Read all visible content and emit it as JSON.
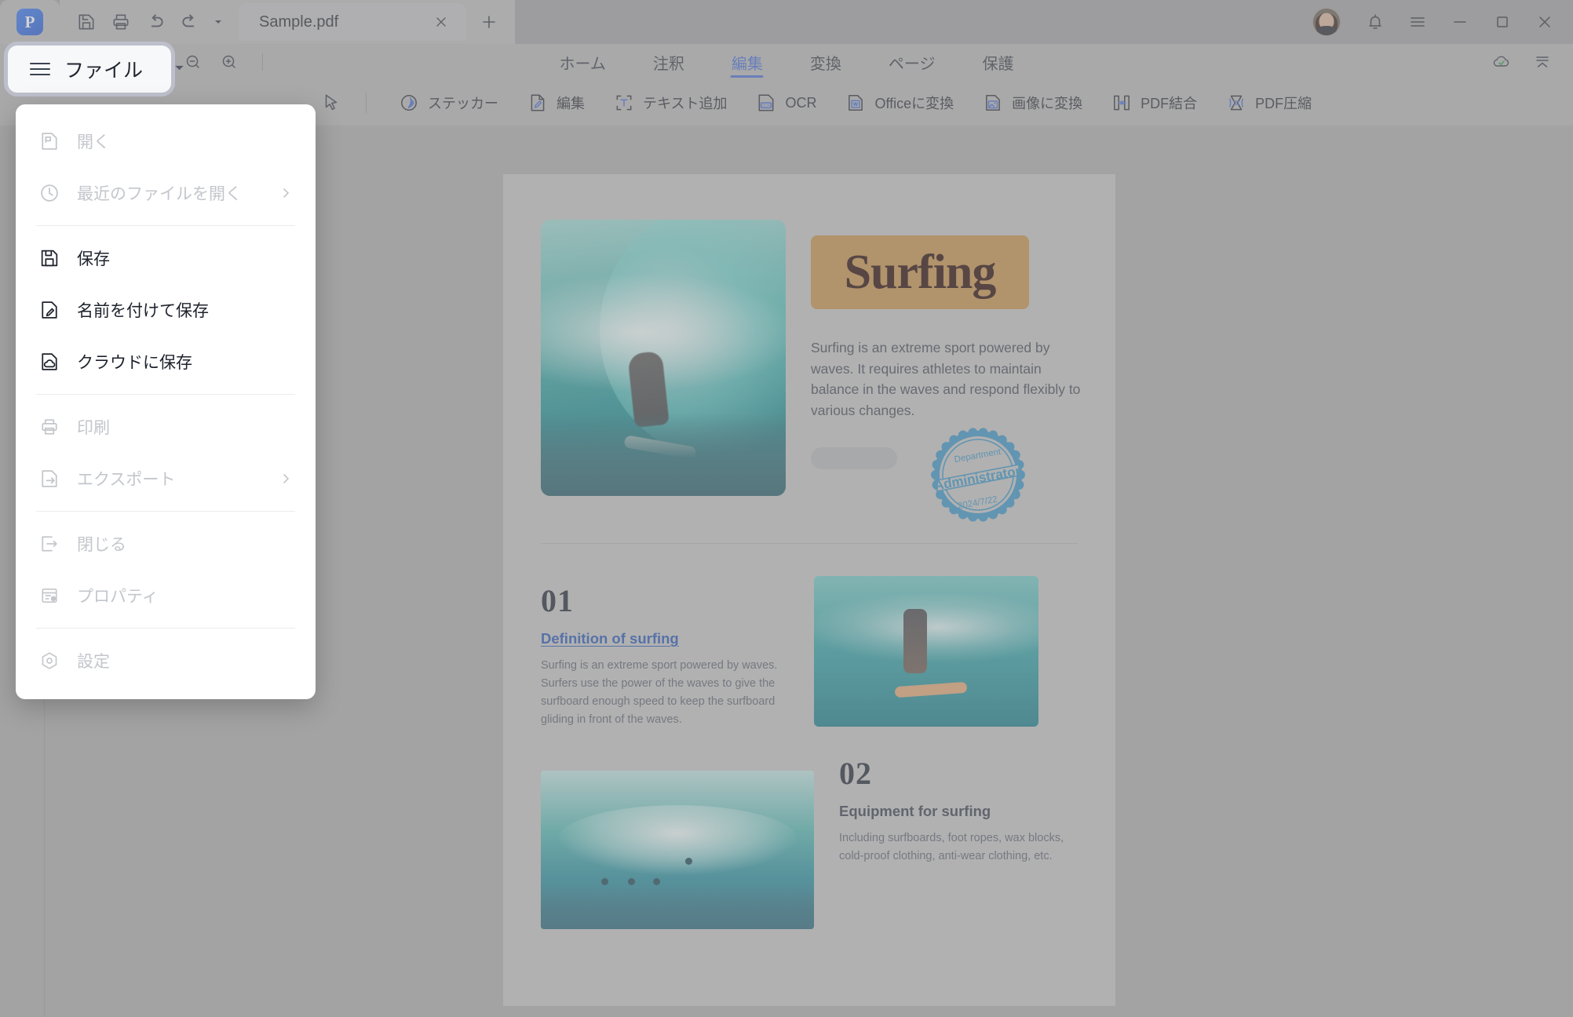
{
  "app": {
    "logo_letter": "P",
    "window_title": "Sample.pdf"
  },
  "titlebar": {
    "quick_access": [
      {
        "name": "save",
        "label": "保存"
      },
      {
        "name": "print",
        "label": "印刷"
      },
      {
        "name": "undo",
        "label": "元に戻す"
      },
      {
        "name": "redo",
        "label": "やり直し"
      }
    ],
    "tab_label": "Sample.pdf",
    "new_tab_label": "+",
    "window_controls": [
      {
        "name": "minimize",
        "label": "—"
      },
      {
        "name": "maximize",
        "label": "□"
      },
      {
        "name": "close",
        "label": "✕"
      }
    ]
  },
  "file_button": {
    "label": "ファイル"
  },
  "zoom_controls": {
    "zoom_out_label": "縮小",
    "zoom_in_label": "拡大"
  },
  "ribbon": {
    "tabs": [
      {
        "label": "ホーム",
        "active": false
      },
      {
        "label": "注釈",
        "active": false
      },
      {
        "label": "編集",
        "active": true
      },
      {
        "label": "変換",
        "active": false
      },
      {
        "label": "ページ",
        "active": false
      },
      {
        "label": "保護",
        "active": false
      }
    ],
    "active_tab": "編集",
    "accent_color": "#4a6fd4"
  },
  "toolbar": {
    "items": [
      {
        "label": "ステッカー",
        "icon": "sticker-icon"
      },
      {
        "label": "編集",
        "icon": "edit-pencil-icon"
      },
      {
        "label": "テキスト追加",
        "icon": "add-text-icon"
      },
      {
        "label": "OCR",
        "icon": "ocr-icon"
      },
      {
        "label": "Officeに変換",
        "icon": "convert-to-office-icon"
      },
      {
        "label": "画像に変換",
        "icon": "convert-to-image-icon"
      },
      {
        "label": "PDF結合",
        "icon": "merge-pdf-icon"
      },
      {
        "label": "PDF圧縮",
        "icon": "compress-pdf-icon"
      }
    ]
  },
  "file_menu": {
    "items": [
      {
        "label": "開く",
        "icon": "open-file-icon",
        "disabled": true,
        "submenu": false
      },
      {
        "label": "最近のファイルを開く",
        "icon": "recent-clock-icon",
        "disabled": true,
        "submenu": true
      },
      {
        "label": "保存",
        "icon": "save-disk-icon",
        "disabled": false,
        "submenu": false
      },
      {
        "label": "名前を付けて保存",
        "icon": "save-as-icon",
        "disabled": false,
        "submenu": false
      },
      {
        "label": "クラウドに保存",
        "icon": "save-cloud-icon",
        "disabled": false,
        "submenu": false
      },
      {
        "label": "印刷",
        "icon": "printer-icon",
        "disabled": true,
        "submenu": false
      },
      {
        "label": "エクスポート",
        "icon": "export-icon",
        "disabled": true,
        "submenu": true
      },
      {
        "label": "閉じる",
        "icon": "close-doc-icon",
        "disabled": true,
        "submenu": false
      },
      {
        "label": "プロパティ",
        "icon": "properties-icon",
        "disabled": true,
        "submenu": false
      },
      {
        "label": "設定",
        "icon": "settings-gear-icon",
        "disabled": true,
        "submenu": false
      }
    ],
    "separators_after": [
      1,
      4,
      6,
      8
    ]
  },
  "document": {
    "title_badge": "Surfing",
    "title_badge_color": "#c4924f",
    "intro": "Surfing is an extreme sport powered by waves. It requires athletes to maintain balance in the waves and respond flexibly to various changes.",
    "stamp": {
      "top_text": "Department",
      "main_text": "Administrator",
      "date_text": "2024/7/22",
      "color": "#3d94c4"
    },
    "sections": [
      {
        "number": "01",
        "heading": "Definition of surfing",
        "heading_is_link": true,
        "body": "Surfing is an extreme sport powered by waves. Surfers use the power of the waves to give the surfboard enough speed to keep the surfboard gliding in front of the waves."
      },
      {
        "number": "02",
        "heading": "Equipment for surfing",
        "heading_is_link": false,
        "body": "Including surfboards, foot ropes, wax blocks, cold-proof clothing, anti-wear clothing, etc."
      }
    ]
  }
}
